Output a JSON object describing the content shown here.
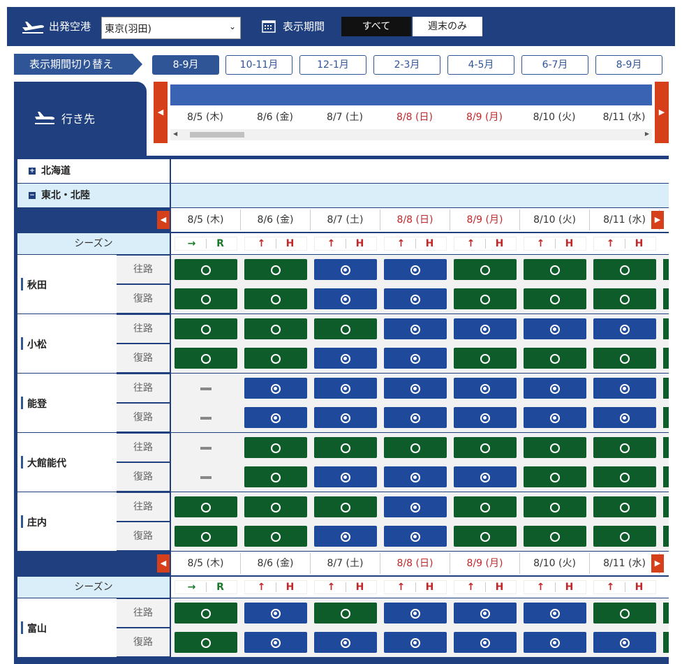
{
  "header": {
    "origin_label": "出発空港",
    "origin_value": "東京(羽田)",
    "period_label": "表示期間",
    "btn_all": "すべて",
    "btn_weekend": "週末のみ"
  },
  "switcher": {
    "label": "表示期間切り替え",
    "tabs": [
      "8-9月",
      "10-11月",
      "12-1月",
      "2-3月",
      "4-5月",
      "6-7月",
      "8-9月"
    ]
  },
  "destination": {
    "label": "行き先"
  },
  "dates": [
    {
      "label": "8/5 (木)",
      "holiday": false
    },
    {
      "label": "8/6 (金)",
      "holiday": false
    },
    {
      "label": "8/7 (土)",
      "holiday": false
    },
    {
      "label": "8/8 (日)",
      "holiday": true
    },
    {
      "label": "8/9 (月)",
      "holiday": true
    },
    {
      "label": "8/10 (火)",
      "holiday": false
    },
    {
      "label": "8/11 (水)",
      "holiday": false
    }
  ],
  "season_label": "シーズン",
  "seasons": [
    {
      "icon": "→",
      "code": "R"
    },
    {
      "icon": "↑",
      "code": "H"
    },
    {
      "icon": "↑",
      "code": "H"
    },
    {
      "icon": "↑",
      "code": "H"
    },
    {
      "icon": "↑",
      "code": "H"
    },
    {
      "icon": "↑",
      "code": "H"
    },
    {
      "icon": "↑",
      "code": "H"
    }
  ],
  "regions": [
    {
      "name": "北海道",
      "collapsed": true
    },
    {
      "name": "東北・北陸",
      "collapsed": false
    }
  ],
  "dir_labels": {
    "out": "往路",
    "ret": "復路"
  },
  "legend_note": "g = 緑 ○, b = 青 ◎, n = ー",
  "cities": [
    {
      "name": "秋田",
      "out": [
        "g",
        "g",
        "b",
        "b",
        "g",
        "g",
        "g"
      ],
      "ret": [
        "g",
        "g",
        "b",
        "b",
        "g",
        "g",
        "g"
      ]
    },
    {
      "name": "小松",
      "out": [
        "g",
        "g",
        "g",
        "b",
        "b",
        "b",
        "b"
      ],
      "ret": [
        "g",
        "g",
        "b",
        "b",
        "g",
        "g",
        "g"
      ]
    },
    {
      "name": "能登",
      "out": [
        "n",
        "b",
        "b",
        "b",
        "b",
        "b",
        "b"
      ],
      "ret": [
        "n",
        "b",
        "b",
        "b",
        "b",
        "b",
        "b"
      ]
    },
    {
      "name": "大館能代",
      "out": [
        "n",
        "g",
        "g",
        "g",
        "g",
        "g",
        "g"
      ],
      "ret": [
        "n",
        "g",
        "b",
        "b",
        "b",
        "g",
        "g"
      ]
    },
    {
      "name": "庄内",
      "out": [
        "g",
        "g",
        "g",
        "b",
        "g",
        "g",
        "g"
      ],
      "ret": [
        "g",
        "g",
        "b",
        "b",
        "g",
        "g",
        "g"
      ]
    },
    {
      "name": "富山",
      "out": [
        "g",
        "b",
        "g",
        "b",
        "b",
        "b",
        "g"
      ],
      "ret": [
        "g",
        "b",
        "b",
        "b",
        "b",
        "b",
        "b"
      ]
    }
  ],
  "colors": {
    "navy": "#1f3f7f",
    "green": "#0f5c2b",
    "blue": "#1f4a9c",
    "red": "#d5401b",
    "holiday": "#c0282a",
    "season_bg": "#d9eef8"
  }
}
